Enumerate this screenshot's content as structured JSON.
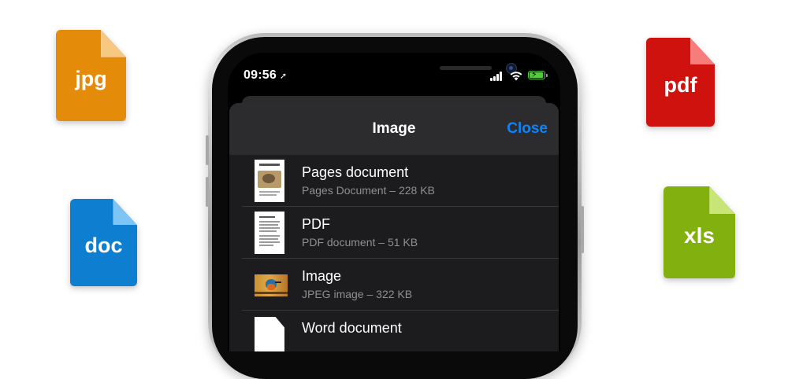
{
  "file_icons": [
    {
      "label": "jpg",
      "color": "#e58b0a",
      "fold_color": "#f7c882"
    },
    {
      "label": "doc",
      "color": "#0e7fd0",
      "fold_color": "#7cc5f4"
    },
    {
      "label": "pdf",
      "color": "#d0120f",
      "fold_color": "#f77d7a"
    },
    {
      "label": "xls",
      "color": "#82b00e",
      "fold_color": "#c7e677"
    }
  ],
  "status_bar": {
    "time": "09:56",
    "location_icon": "location-arrow-icon",
    "battery_color": "#55c940"
  },
  "sheet": {
    "title": "Image",
    "close_label": "Close",
    "accent_color": "#0a84ff",
    "rows": [
      {
        "title": "Pages document",
        "subtitle": "Pages Document – 228 KB",
        "thumb": "pages-thumbnail"
      },
      {
        "title": "PDF",
        "subtitle": "PDF document – 51 KB",
        "thumb": "pdf-thumbnail"
      },
      {
        "title": "Image",
        "subtitle": "JPEG image – 322 KB",
        "thumb": "bird-photo-thumbnail"
      },
      {
        "title": "Word document",
        "subtitle": "",
        "thumb": "word-thumbnail"
      }
    ]
  }
}
